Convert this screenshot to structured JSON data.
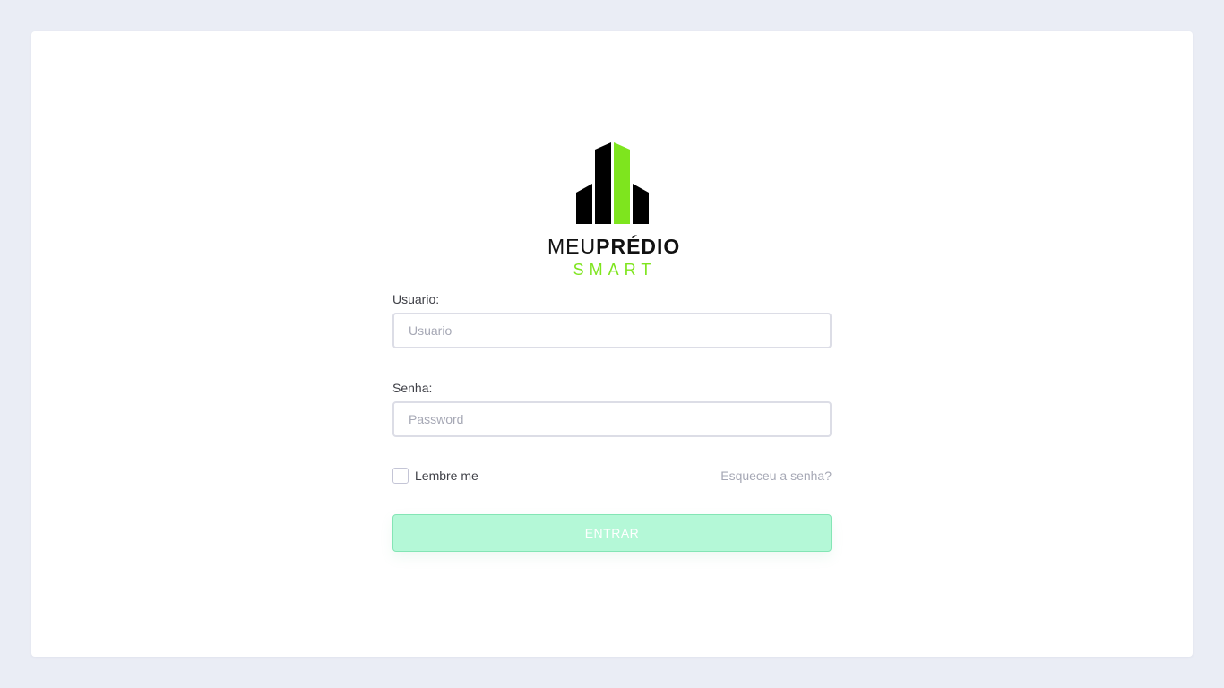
{
  "brand": {
    "name_light": "MEU",
    "name_bold": "PRÉDIO",
    "tagline": "SMART",
    "accent_color": "#7ee51e"
  },
  "form": {
    "username": {
      "label": "Usuario:",
      "placeholder": "Usuario",
      "value": ""
    },
    "password": {
      "label": "Senha:",
      "placeholder": "Password",
      "value": ""
    },
    "remember": {
      "label": "Lembre me",
      "checked": false
    },
    "forgot_link": "Esqueceu a senha?",
    "submit_label": "ENTRAR"
  },
  "colors": {
    "background": "#eaedf5",
    "submit_bg": "#b4f8d7"
  }
}
